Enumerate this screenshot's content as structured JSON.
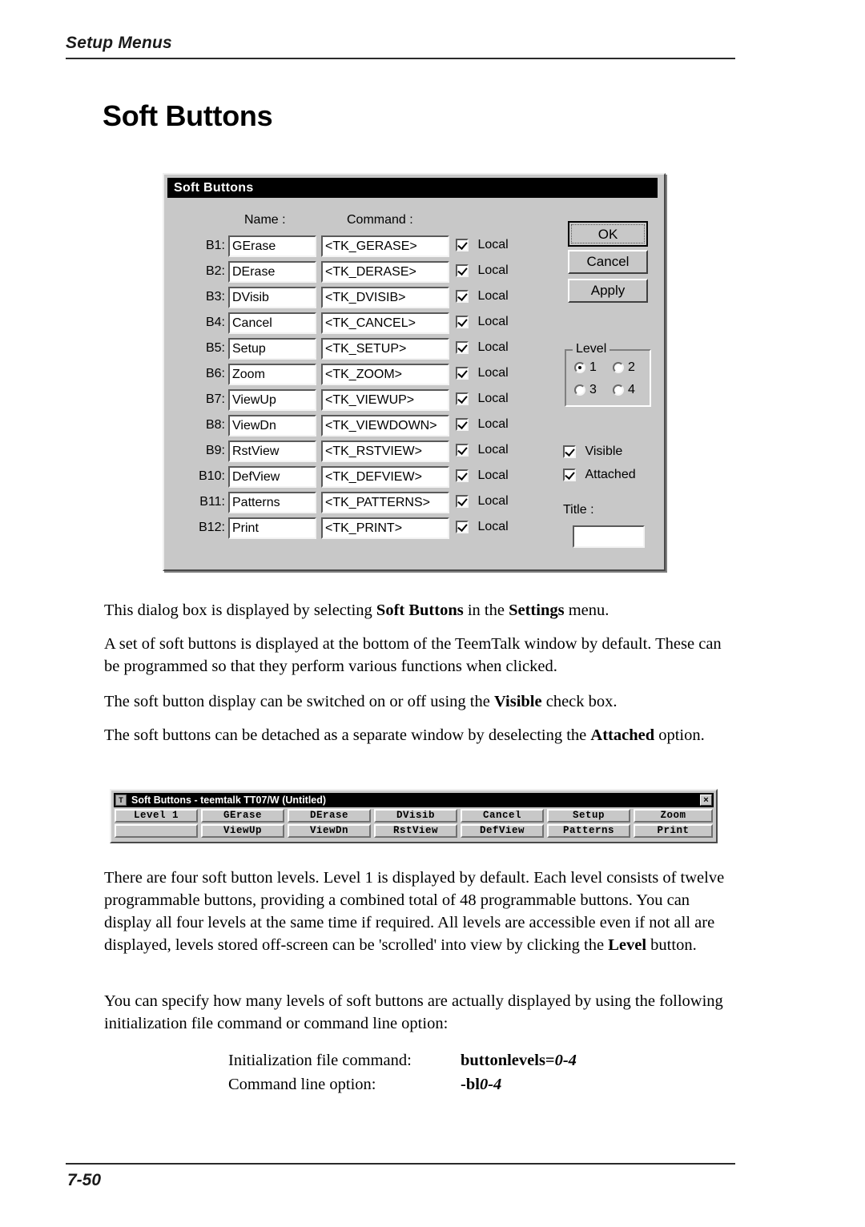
{
  "page": {
    "header": "Setup Menus",
    "title": "Soft Buttons",
    "number": "7-50"
  },
  "dialog": {
    "titlebar": "Soft Buttons",
    "headers": {
      "name": "Name :",
      "command": "Command :"
    },
    "local_label": "Local",
    "rows": [
      {
        "id": "B1:",
        "name": "GErase",
        "command": "<TK_GERASE>",
        "local": true
      },
      {
        "id": "B2:",
        "name": "DErase",
        "command": "<TK_DERASE>",
        "local": true
      },
      {
        "id": "B3:",
        "name": "DVisib",
        "command": "<TK_DVISIB>",
        "local": true
      },
      {
        "id": "B4:",
        "name": "Cancel",
        "command": "<TK_CANCEL>",
        "local": true
      },
      {
        "id": "B5:",
        "name": "Setup",
        "command": "<TK_SETUP>",
        "local": true
      },
      {
        "id": "B6:",
        "name": "Zoom",
        "command": "<TK_ZOOM>",
        "local": true
      },
      {
        "id": "B7:",
        "name": "ViewUp",
        "command": "<TK_VIEWUP>",
        "local": true
      },
      {
        "id": "B8:",
        "name": "ViewDn",
        "command": "<TK_VIEWDOWN>",
        "local": true
      },
      {
        "id": "B9:",
        "name": "RstView",
        "command": "<TK_RSTVIEW>",
        "local": true
      },
      {
        "id": "B10:",
        "name": "DefView",
        "command": "<TK_DEFVIEW>",
        "local": true
      },
      {
        "id": "B11:",
        "name": "Patterns",
        "command": "<TK_PATTERNS>",
        "local": true
      },
      {
        "id": "B12:",
        "name": "Print",
        "command": "<TK_PRINT>",
        "local": true
      }
    ],
    "buttons": {
      "ok": "OK",
      "cancel": "Cancel",
      "apply": "Apply"
    },
    "level_group": {
      "legend": "Level",
      "options": [
        "1",
        "2",
        "3",
        "4"
      ],
      "selected": "1"
    },
    "checkboxes": [
      {
        "label": "Visible",
        "checked": true
      },
      {
        "label": "Attached",
        "checked": true
      }
    ],
    "title_field": {
      "label": "Title :",
      "value": ""
    }
  },
  "paragraphs": {
    "p1_pre": "This dialog box is displayed by selecting ",
    "p1_b1": "Soft Buttons",
    "p1_mid": " in the ",
    "p1_b2": "Settings",
    "p1_post": " menu.",
    "p2": "A set of soft buttons is displayed at the bottom of the TeemTalk window by default. These can be programmed so that they perform various functions when clicked.",
    "p3_pre": "The soft button display can be switched on or off using the ",
    "p3_b1": "Visible",
    "p3_post": " check box.",
    "p4_pre": "The soft buttons can be detached as a separate window by deselecting the ",
    "p4_b1": "Attached",
    "p4_post": " option.",
    "p5_pre": "There are four soft button levels. Level 1 is displayed by default. Each level consists of twelve programmable buttons, providing a combined total of 48 programmable buttons. You can display all four levels at the same time if required. All levels are accessible even if not all are displayed, levels stored off-screen can be 'scrolled' into view by clicking the ",
    "p5_b1": "Level",
    "p5_post": " button.",
    "p6": "You can specify how many levels of soft buttons are actually displayed by using the following initialization file command or command line option:"
  },
  "command_table": [
    {
      "label": "Initialization file command:",
      "bold": "buttonlevels=",
      "italic": "0-4"
    },
    {
      "label": "Command line option:",
      "bold": "-bl",
      "italic": "0-4"
    }
  ],
  "toolbar_window": {
    "caption": "Soft Buttons - teemtalk TT07/W (Untitled)",
    "sysicon": "T",
    "close": "×",
    "row1": [
      "Level 1",
      "GErase",
      "DErase",
      "DVisib",
      "Cancel",
      "Setup",
      "Zoom"
    ],
    "row2": [
      "",
      "ViewUp",
      "ViewDn",
      "RstView",
      "DefView",
      "Patterns",
      "Print"
    ]
  }
}
